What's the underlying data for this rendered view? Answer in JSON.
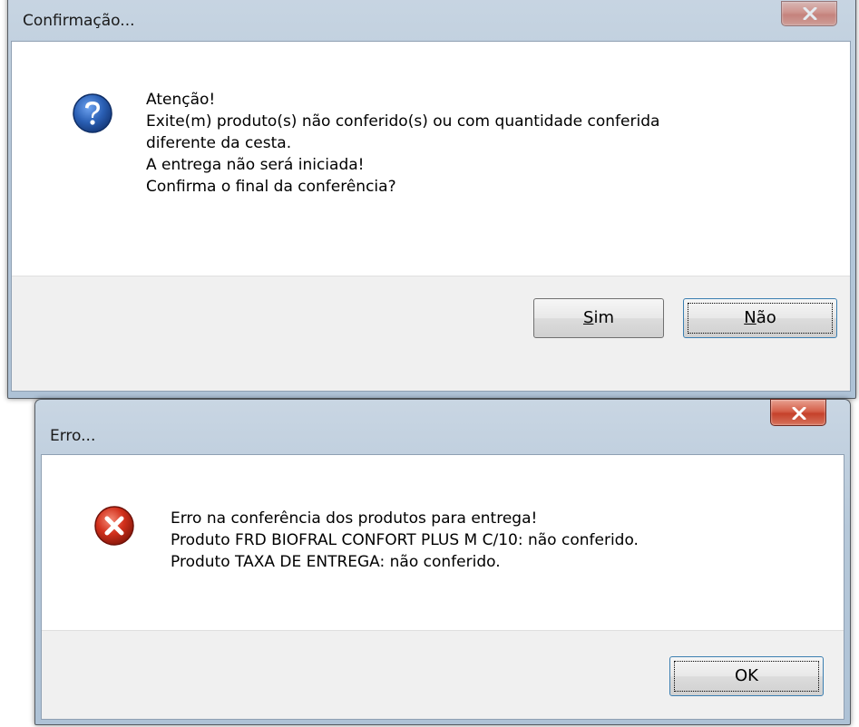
{
  "confirm_dialog": {
    "title": "Confirmação...",
    "message_lines": [
      "Atenção!",
      "Exite(m) produto(s) não conferido(s) ou com quantidade conferida",
      "diferente da cesta.",
      "A entrega não será iniciada!",
      "Confirma o final da conferência?"
    ],
    "buttons": {
      "yes": {
        "mnemonic": "S",
        "rest": "im"
      },
      "no": {
        "mnemonic": "N",
        "rest": "ão"
      }
    },
    "icon": "question-icon",
    "close_icon": "close-icon"
  },
  "error_dialog": {
    "title": "Erro...",
    "message_lines": [
      "Erro na conferência dos produtos para entrega!",
      "Produto FRD BIOFRAL CONFORT PLUS M C/10: não conferido.",
      "Produto TAXA DE ENTREGA: não conferido."
    ],
    "buttons": {
      "ok": "OK"
    },
    "icon": "error-icon",
    "close_icon": "close-icon"
  },
  "colors": {
    "title_bar": "#b6c8d9",
    "close_button": "#c5412b",
    "question_icon": "#2a5fb4",
    "error_icon": "#d2301c",
    "footer": "#f0f0f0"
  }
}
